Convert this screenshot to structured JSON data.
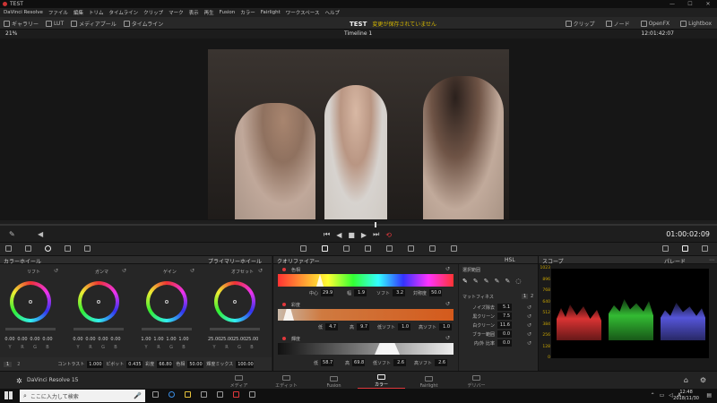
{
  "window": {
    "title": "TEST"
  },
  "menu": {
    "items": [
      "DaVinci Resolve",
      "ファイル",
      "編集",
      "トリム",
      "タイムライン",
      "クリップ",
      "マーク",
      "表示",
      "再生",
      "Fusion",
      "カラー",
      "Fairlight",
      "ワークスペース",
      "ヘルプ"
    ]
  },
  "toolbar": {
    "gallery": "ギャラリー",
    "lut": "LUT",
    "media_pool": "メディアプール",
    "timeline": "タイムライン",
    "project_name": "TEST",
    "save_status": "変更が保存されていません",
    "clip": "クリップ",
    "node": "ノード",
    "openfx": "OpenFX",
    "lightbox": "Lightbox"
  },
  "viewer": {
    "zoom": "21%",
    "timeline_name": "Timeline 1",
    "timecode_top": "12:01:42:07",
    "timecode": "01:00:02:09"
  },
  "color_wheels": {
    "panel_title": "カラーホイール",
    "mode": "プライマリーホイール",
    "wheels": [
      {
        "name": "リフト",
        "values": [
          "0.00",
          "0.00",
          "0.00",
          "0.00"
        ]
      },
      {
        "name": "ガンマ",
        "values": [
          "0.00",
          "0.00",
          "0.00",
          "0.00"
        ]
      },
      {
        "name": "ゲイン",
        "values": [
          "1.00",
          "1.00",
          "1.00",
          "1.00"
        ]
      },
      {
        "name": "オフセット",
        "values": [
          "25.00",
          "25.00",
          "25.00",
          "25.00"
        ]
      }
    ],
    "channels": [
      "Y",
      "R",
      "G",
      "B"
    ],
    "page_1": "1",
    "page_2": "2",
    "bottom": {
      "contrast_label": "コントラスト",
      "contrast": "1.000",
      "pivot_label": "ピボット",
      "pivot": "0.435",
      "sat_label": "彩度",
      "sat": "66.80",
      "hue_label": "色相",
      "hue": "50.00",
      "lummix_label": "輝度ミックス",
      "lummix": "100.00"
    }
  },
  "qualifier": {
    "panel_title": "クオリファイアー",
    "hue": {
      "label": "色相",
      "center_label": "中心",
      "center": "29.9",
      "width_label": "幅",
      "width": "1.9",
      "soft_label": "ソフト",
      "soft": "3.2",
      "sym_label": "対称度",
      "sym": "50.0"
    },
    "sat": {
      "label": "彩度",
      "low_label": "低",
      "low": "4.7",
      "high_label": "高",
      "high": "9.7",
      "lsoft_label": "低ソフト",
      "lsoft": "1.0",
      "hsoft_label": "高ソフト",
      "hsoft": "1.0"
    },
    "lum": {
      "label": "輝度",
      "low_label": "低",
      "low": "58.7",
      "high_label": "高",
      "high": "69.8",
      "lsoft_label": "低ソフト",
      "lsoft": "2.6",
      "hsoft_label": "高ソフト",
      "hsoft": "2.6"
    },
    "hsl": "HSL"
  },
  "selection": {
    "title": "選択範囲",
    "matte_finesse": "マットフィネス",
    "page_1": "1",
    "page_2": "2",
    "rows": [
      {
        "label": "ノイズ除去",
        "value": "5.1"
      },
      {
        "label": "黒クリーン",
        "value": "7.5"
      },
      {
        "label": "白クリーン",
        "value": "11.6"
      },
      {
        "label": "ブラー範囲",
        "value": "0.0"
      },
      {
        "label": "内/外 比率",
        "value": "0.0"
      }
    ]
  },
  "scopes": {
    "title": "スコープ",
    "mode": "パレード",
    "scale": [
      "1023",
      "896",
      "768",
      "640",
      "512",
      "384",
      "256",
      "128",
      "0"
    ]
  },
  "pages": {
    "app_name": "DaVinci Resolve 15",
    "tabs": [
      "メディア",
      "エディット",
      "Fusion",
      "カラー",
      "Fairlight",
      "デリバー"
    ],
    "active": "カラー"
  },
  "taskbar": {
    "search_placeholder": "ここに入力して検索",
    "time": "12:48",
    "date": "2018/11/30"
  },
  "colors": {
    "accent": "#e0383c",
    "yellow": "#d6b800",
    "bg": "#1e1e1e"
  }
}
